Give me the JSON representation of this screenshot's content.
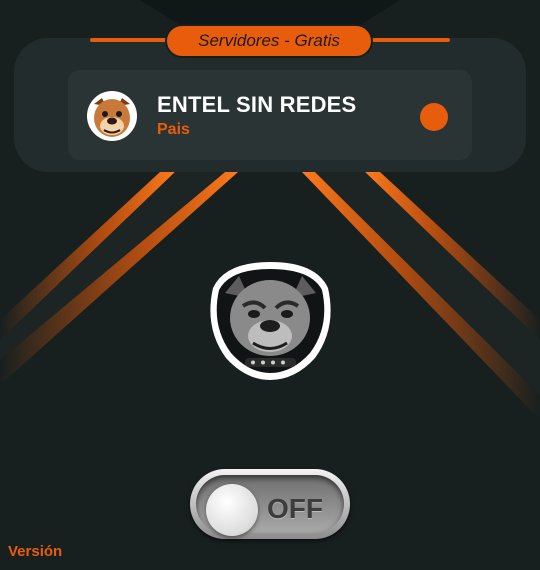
{
  "header": {
    "title": "Servidores - Gratis"
  },
  "server": {
    "name": "ENTEL SIN REDES",
    "country": "Pais"
  },
  "toggle": {
    "state_label": "OFF"
  },
  "footer": {
    "version_label": "Versión"
  },
  "colors": {
    "accent": "#e85d0c",
    "background": "#18201f",
    "panel": "#232c2c",
    "card": "#2b3434"
  },
  "icons": {
    "server_flag": "bulldog-icon",
    "main_logo": "bulldog-logo-icon"
  }
}
